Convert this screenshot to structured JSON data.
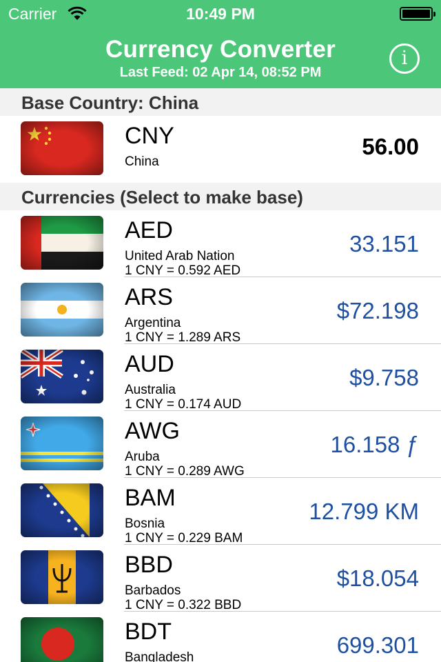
{
  "status_bar": {
    "carrier": "Carrier",
    "time": "10:49 PM"
  },
  "nav": {
    "title": "Currency Converter",
    "subtitle": "Last Feed: 02 Apr 14, 08:52 PM",
    "info_icon": "info-icon",
    "accent_color": "#4cc77a"
  },
  "base": {
    "header": "Base Country: China",
    "code": "CNY",
    "country": "China",
    "amount": "56.00",
    "flag_icon": "china-flag-icon"
  },
  "currencies": {
    "header": "Currencies (Select to make base)",
    "amount_color": "#1f4fa0",
    "items": [
      {
        "code": "AED",
        "country": "United Arab Nation",
        "rate": "1 CNY = 0.592 AED",
        "amount": "33.151",
        "flag_icon": "uae-flag-icon"
      },
      {
        "code": "ARS",
        "country": "Argentina",
        "rate": "1 CNY = 1.289 ARS",
        "amount": "$72.198",
        "flag_icon": "argentina-flag-icon"
      },
      {
        "code": "AUD",
        "country": "Australia",
        "rate": "1 CNY = 0.174 AUD",
        "amount": "$9.758",
        "flag_icon": "australia-flag-icon"
      },
      {
        "code": "AWG",
        "country": "Aruba",
        "rate": "1 CNY = 0.289 AWG",
        "amount": "16.158 ƒ",
        "flag_icon": "aruba-flag-icon"
      },
      {
        "code": "BAM",
        "country": "Bosnia",
        "rate": "1 CNY = 0.229 BAM",
        "amount": "12.799 KM",
        "flag_icon": "bosnia-flag-icon"
      },
      {
        "code": "BBD",
        "country": "Barbados",
        "rate": "1 CNY = 0.322 BBD",
        "amount": "$18.054",
        "flag_icon": "barbados-flag-icon"
      },
      {
        "code": "BDT",
        "country": "Bangladesh",
        "rate": "",
        "amount": "699.301",
        "flag_icon": "bangladesh-flag-icon"
      }
    ]
  }
}
